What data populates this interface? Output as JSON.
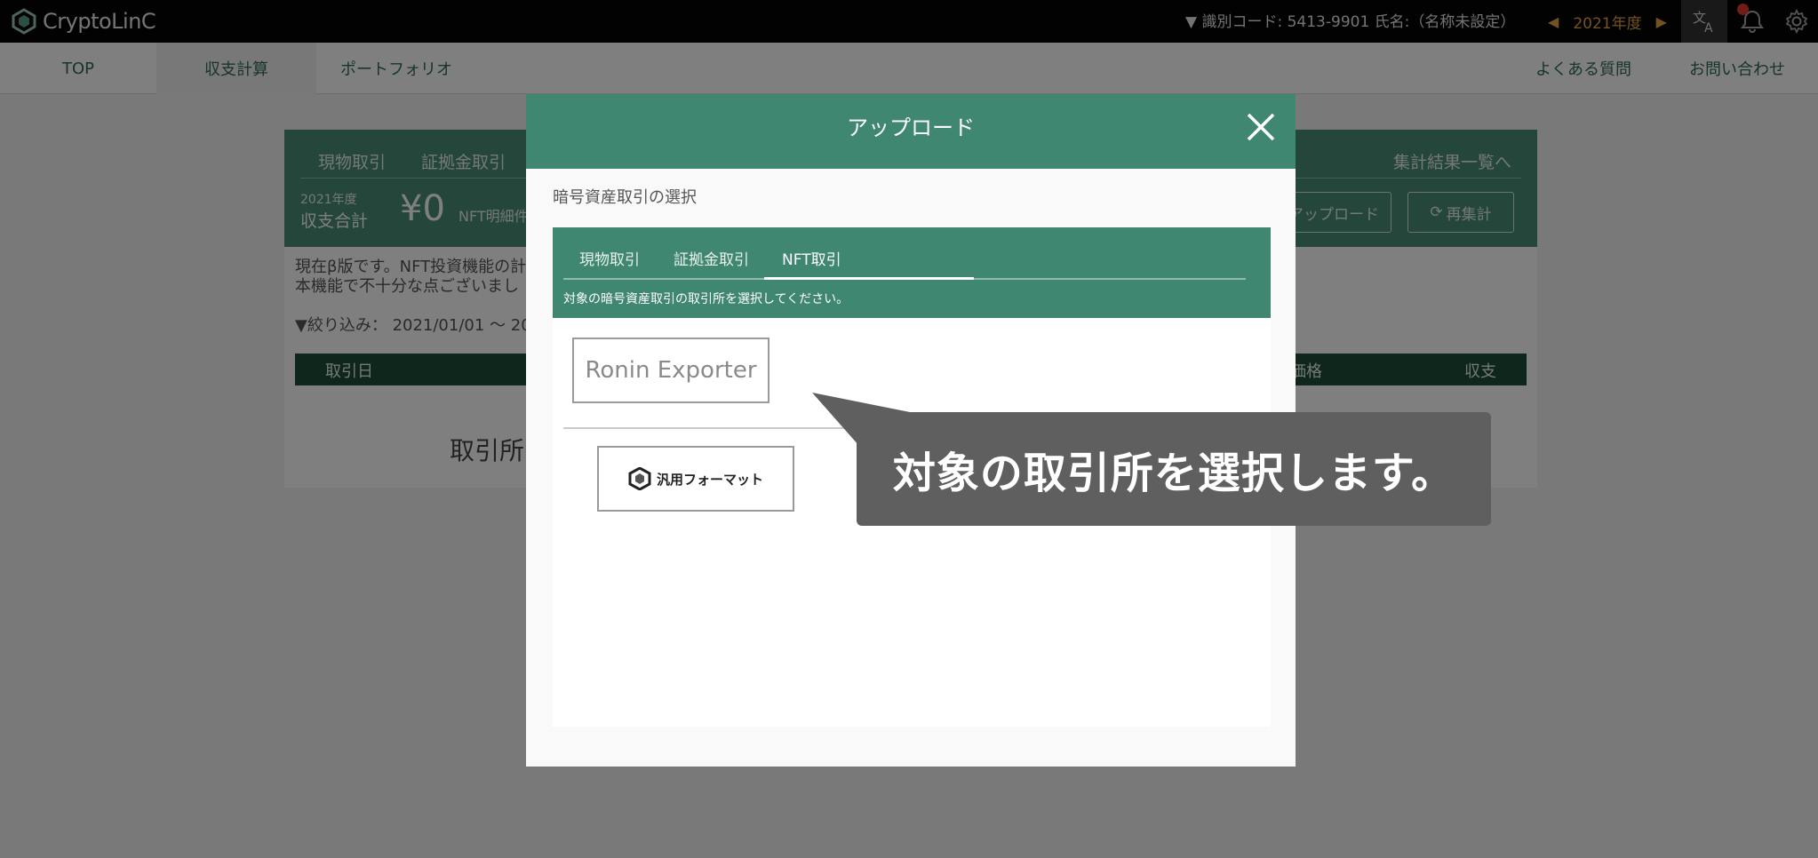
{
  "app": {
    "logo_text": "CryptoLinC"
  },
  "header": {
    "user_info": "▼ 識別コード: 5413-9901  氏名:（名称未設定）",
    "year": "2021年度",
    "icons": [
      "translate-icon",
      "bell-icon",
      "gear-icon"
    ]
  },
  "nav": {
    "top": "TOP",
    "calc": "収支計算",
    "portfolio": "ポートフォリオ",
    "faq": "よくある質問",
    "contact": "お問い合わせ"
  },
  "card": {
    "tab_spot": "現物取引",
    "tab_margin": "証拠金取引",
    "year": "2021年度",
    "total_label": "収支合計",
    "total_value": "¥0",
    "nft_detail": "NFT明細件",
    "result_link": "集計結果一覧へ",
    "upload_btn": "アップロード",
    "recalc_btn": "再集計",
    "notice_line1": "現在β版です。NFT投資機能の計",
    "notice_line2": "本機能で不十分な点ございまし",
    "filter": "▼絞り込み： 2021/01/01 〜 202",
    "table_headers": {
      "date": "取引日",
      "price": "価格",
      "pl": "収支"
    },
    "empty_text": "取引所"
  },
  "modal": {
    "title": "アップロード",
    "subtitle": "暗号資産取引の選択",
    "tabs": [
      "現物取引",
      "証拠金取引",
      "NFT取引"
    ],
    "active_tab": "NFT取引",
    "instruction": "対象の暗号資産取引の取引所を選択してください。",
    "exchanges": {
      "ronin": "Ronin Exporter",
      "generic": "汎用フォーマット"
    }
  },
  "callout": {
    "text": "対象の取引所を選択します。"
  },
  "colors": {
    "accent": "#3f8770",
    "year": "#e5a545",
    "dark_header": "#1f4c3b"
  }
}
